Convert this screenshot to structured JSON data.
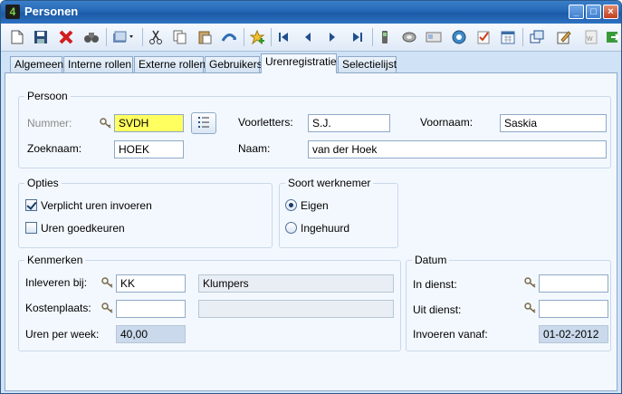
{
  "window": {
    "title": "Personen",
    "app_icon_glyph": "4",
    "minimize_glyph": "_",
    "maximize_glyph": "□",
    "close_glyph": "×"
  },
  "tabs": [
    {
      "label": "Algemeen",
      "active": false
    },
    {
      "label": "Interne rollen",
      "active": false
    },
    {
      "label": "Externe rollen",
      "active": false
    },
    {
      "label": "Gebruikers",
      "active": false
    },
    {
      "label": "Urenregistratie",
      "active": true
    },
    {
      "label": "Selectielijst",
      "active": false
    }
  ],
  "persoon": {
    "group_label": "Persoon",
    "nummer_label": "Nummer:",
    "nummer_value": "SVDH",
    "voorletters_label": "Voorletters:",
    "voorletters_value": "S.J.",
    "voornaam_label": "Voornaam:",
    "voornaam_value": "Saskia",
    "zoeknaam_label": "Zoeknaam:",
    "zoeknaam_value": "HOEK",
    "naam_label": "Naam:",
    "naam_value": "van der Hoek"
  },
  "opties": {
    "group_label": "Opties",
    "verplicht_label": "Verplicht uren invoeren",
    "verplicht_checked": true,
    "goedkeuren_label": "Uren goedkeuren",
    "goedkeuren_checked": false
  },
  "soort": {
    "group_label": "Soort werknemer",
    "eigen_label": "Eigen",
    "eigen_selected": true,
    "ingehuurd_label": "Ingehuurd",
    "ingehuurd_selected": false
  },
  "kenmerken": {
    "group_label": "Kenmerken",
    "inleveren_label": "Inleveren bij:",
    "inleveren_code": "KK",
    "inleveren_name": "Klumpers",
    "kostenplaats_label": "Kostenplaats:",
    "kostenplaats_code": "",
    "kostenplaats_name": "",
    "uren_label": "Uren per week:",
    "uren_value": "40,00"
  },
  "datum": {
    "group_label": "Datum",
    "in_dienst_label": "In dienst:",
    "in_dienst_value": "",
    "uit_dienst_label": "Uit dienst:",
    "uit_dienst_value": "",
    "invoeren_label": "Invoeren vanaf:",
    "invoeren_value": "01-02-2012"
  },
  "colors": {
    "title_bar": "#2468b6",
    "panel_bg": "#f3f8fe",
    "highlight_field": "#ffff60",
    "readonly_field": "#cad9ec"
  },
  "toolbar_icons": [
    "new-document-icon",
    "save-icon",
    "delete-icon",
    "binoculars-icon",
    "folder-dropdown-icon",
    "cut-icon",
    "copy-icon",
    "paste-icon",
    "refresh-icon",
    "favorite-add-icon",
    "first-record-icon",
    "previous-record-icon",
    "next-record-icon",
    "last-record-icon",
    "phone-icon",
    "link-icon",
    "card-icon",
    "web-icon",
    "checklist-icon",
    "calendar-icon",
    "windows-icon",
    "edit-icon",
    "word-icon",
    "export-icon"
  ]
}
